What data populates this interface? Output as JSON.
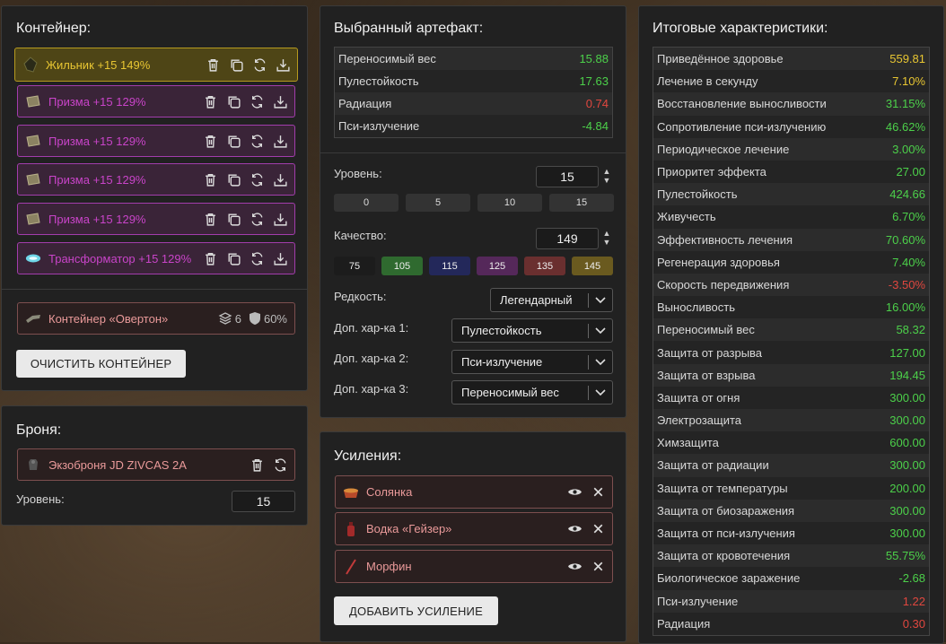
{
  "container": {
    "title": "Контейнер:",
    "artifacts": [
      {
        "name": "Жильник +15 149%",
        "quality": "gold"
      },
      {
        "name": "Призма +15 129%",
        "quality": "purple"
      },
      {
        "name": "Призма +15 129%",
        "quality": "purple"
      },
      {
        "name": "Призма +15 129%",
        "quality": "purple"
      },
      {
        "name": "Призма +15 129%",
        "quality": "purple"
      },
      {
        "name": "Трансформатор +15 129%",
        "quality": "purple"
      }
    ],
    "container_item": {
      "name": "Контейнер «Овертон»",
      "slots": "6",
      "protection": "60%"
    },
    "clear_button": "ОЧИСТИТЬ КОНТЕЙНЕР"
  },
  "armor": {
    "title": "Броня:",
    "item": "Экзоброня JD ZIVCAS 2A",
    "level_label": "Уровень:",
    "level_value": "15"
  },
  "selected": {
    "title": "Выбранный артефакт:",
    "stats": [
      {
        "name": "Переносимый вес",
        "value": "15.88",
        "color": "green"
      },
      {
        "name": "Пулестойкость",
        "value": "17.63",
        "color": "green"
      },
      {
        "name": "Радиация",
        "value": "0.74",
        "color": "red"
      },
      {
        "name": "Пси-излучение",
        "value": "-4.84",
        "color": "green"
      }
    ],
    "level_label": "Уровень:",
    "level_value": "15",
    "level_presets": [
      "0",
      "5",
      "10",
      "15"
    ],
    "quality_label": "Качество:",
    "quality_value": "149",
    "quality_presets": [
      {
        "label": "75",
        "color": "#1c1c1c"
      },
      {
        "label": "105",
        "color": "#2f6a2f"
      },
      {
        "label": "115",
        "color": "#23285a"
      },
      {
        "label": "125",
        "color": "#55285a"
      },
      {
        "label": "135",
        "color": "#6a2f2f"
      },
      {
        "label": "145",
        "color": "#6a5a1f"
      }
    ],
    "rarity_label": "Редкость:",
    "rarity_value": "Легендарный",
    "extra1_label": "Доп. хар-ка 1:",
    "extra1_value": "Пулестойкость",
    "extra2_label": "Доп. хар-ка 2:",
    "extra2_value": "Пси-излучение",
    "extra3_label": "Доп. хар-ка 3:",
    "extra3_value": "Переносимый вес"
  },
  "boosts": {
    "title": "Усиления:",
    "items": [
      "Солянка",
      "Водка «Гейзер»",
      "Морфин"
    ],
    "add_button": "ДОБАВИТЬ УСИЛЕНИЕ"
  },
  "totals": {
    "title": "Итоговые характеристики:",
    "rows": [
      {
        "name": "Приведённое здоровье",
        "value": "559.81",
        "color": "yellow"
      },
      {
        "name": "Лечение в секунду",
        "value": "7.10%",
        "color": "yellow"
      },
      {
        "name": "Восстановление выносливости",
        "value": "31.15%",
        "color": "green"
      },
      {
        "name": "Сопротивление пси-излучению",
        "value": "46.62%",
        "color": "green"
      },
      {
        "name": "Периодическое лечение",
        "value": "3.00%",
        "color": "green"
      },
      {
        "name": "Приоритет эффекта",
        "value": "27.00",
        "color": "green"
      },
      {
        "name": "Пулестойкость",
        "value": "424.66",
        "color": "green"
      },
      {
        "name": "Живучесть",
        "value": "6.70%",
        "color": "green"
      },
      {
        "name": "Эффективность лечения",
        "value": "70.60%",
        "color": "green"
      },
      {
        "name": "Регенерация здоровья",
        "value": "7.40%",
        "color": "green"
      },
      {
        "name": "Скорость передвижения",
        "value": "-3.50%",
        "color": "red"
      },
      {
        "name": "Выносливость",
        "value": "16.00%",
        "color": "green"
      },
      {
        "name": "Переносимый вес",
        "value": "58.32",
        "color": "green"
      },
      {
        "name": "Защита от разрыва",
        "value": "127.00",
        "color": "green"
      },
      {
        "name": "Защита от взрыва",
        "value": "194.45",
        "color": "green"
      },
      {
        "name": "Защита от огня",
        "value": "300.00",
        "color": "green"
      },
      {
        "name": "Электрозащита",
        "value": "300.00",
        "color": "green"
      },
      {
        "name": "Химзащита",
        "value": "600.00",
        "color": "green"
      },
      {
        "name": "Защита от радиации",
        "value": "300.00",
        "color": "green"
      },
      {
        "name": "Защита от температуры",
        "value": "200.00",
        "color": "green"
      },
      {
        "name": "Защита от биозаражения",
        "value": "300.00",
        "color": "green"
      },
      {
        "name": "Защита от пси-излучения",
        "value": "300.00",
        "color": "green"
      },
      {
        "name": "Защита от кровотечения",
        "value": "55.75%",
        "color": "green"
      },
      {
        "name": "Биологическое заражение",
        "value": "-2.68",
        "color": "green"
      },
      {
        "name": "Пси-излучение",
        "value": "1.22",
        "color": "red"
      },
      {
        "name": "Радиация",
        "value": "0.30",
        "color": "red"
      }
    ]
  }
}
